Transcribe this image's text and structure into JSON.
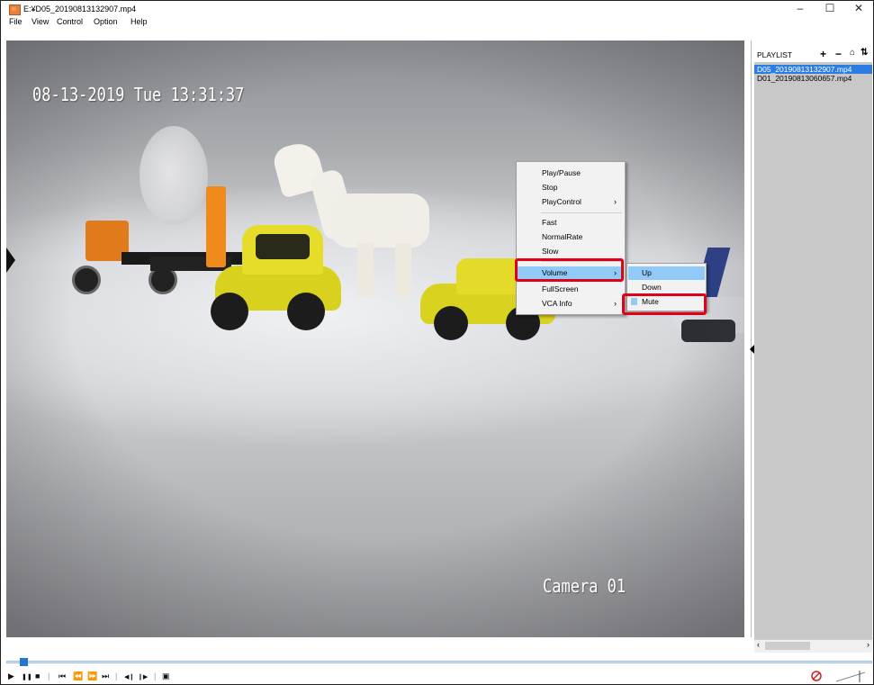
{
  "window": {
    "title": "E:¥D05_20190813132907.mp4",
    "minimize": "–",
    "maximize": "☐",
    "close": "✕"
  },
  "menu": [
    "File",
    "View",
    "Control",
    "Option",
    "Help"
  ],
  "video": {
    "timestamp": "08-13-2019 Tue 13:31:37",
    "camera": "Camera 01"
  },
  "playlist": {
    "title": "PLAYLIST",
    "buttons": [
      "+",
      "−",
      "⌂",
      "⇅"
    ],
    "items": [
      "D05_20190813132907.mp4",
      "D01_20190813060657.mp4"
    ],
    "selected_index": 0
  },
  "context_menu": {
    "items": [
      "Play/Pause",
      "Stop",
      "PlayControl",
      "Fast",
      "NormalRate",
      "Slow",
      "Volume",
      "FullScreen",
      "VCA Info"
    ],
    "submenu_arrow": "›",
    "highlighted": "Volume"
  },
  "volume_submenu": {
    "items": [
      "Up",
      "Down",
      "Mute"
    ],
    "highlighted": "Up",
    "checked": "Mute"
  },
  "controls": {
    "play": "▶",
    "pause": "❚❚",
    "stop": "■",
    "prev": "⏮",
    "rewind": "⏪",
    "fast_forward": "⏩",
    "next": "⏭",
    "frame_back": "◀❙",
    "frame_fwd": "❙▶",
    "snapshot": "▣"
  },
  "colors": {
    "accent": "#2b7de1",
    "highlight": "#91c9f7",
    "annotation_red": "#e0001a"
  }
}
